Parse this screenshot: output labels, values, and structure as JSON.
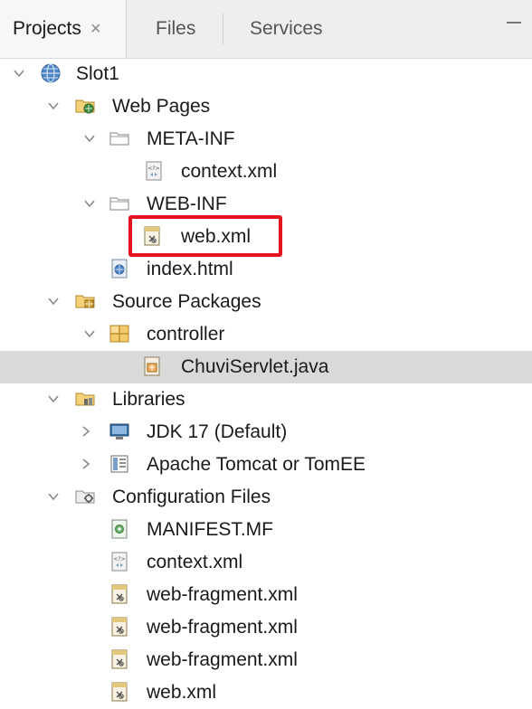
{
  "tabs": [
    {
      "label": "Projects",
      "active": true,
      "close": "×"
    },
    {
      "label": "Files",
      "active": false
    },
    {
      "label": "Services",
      "active": false
    }
  ],
  "tree": [
    {
      "label": "Slot1",
      "icon": "globe-icon",
      "toggle": "expanded"
    },
    {
      "label": "Web Pages",
      "icon": "web-folder-icon",
      "toggle": "expanded"
    },
    {
      "label": "META-INF",
      "icon": "folder-icon",
      "toggle": "expanded"
    },
    {
      "label": "context.xml",
      "icon": "xml-file-icon",
      "toggle": "none"
    },
    {
      "label": "WEB-INF",
      "icon": "folder-icon",
      "toggle": "expanded"
    },
    {
      "label": "web.xml",
      "icon": "web-xml-icon",
      "toggle": "none"
    },
    {
      "label": "index.html",
      "icon": "html-file-icon",
      "toggle": "none"
    },
    {
      "label": "Source Packages",
      "icon": "source-folder-icon",
      "toggle": "expanded"
    },
    {
      "label": "controller",
      "icon": "package-icon",
      "toggle": "expanded"
    },
    {
      "label": "ChuviServlet.java",
      "icon": "servlet-file-icon",
      "toggle": "none",
      "selected": true
    },
    {
      "label": "Libraries",
      "icon": "libraries-icon",
      "toggle": "expanded"
    },
    {
      "label": "JDK 17 (Default)",
      "icon": "jdk-icon",
      "toggle": "collapsed"
    },
    {
      "label": "Apache Tomcat or TomEE",
      "icon": "server-library-icon",
      "toggle": "collapsed"
    },
    {
      "label": "Configuration Files",
      "icon": "config-folder-icon",
      "toggle": "expanded"
    },
    {
      "label": "MANIFEST.MF",
      "icon": "manifest-icon",
      "toggle": "none"
    },
    {
      "label": "context.xml",
      "icon": "xml-file-icon",
      "toggle": "none"
    },
    {
      "label": "web-fragment.xml",
      "icon": "web-xml-icon",
      "toggle": "none"
    },
    {
      "label": "web-fragment.xml",
      "icon": "web-xml-icon",
      "toggle": "none"
    },
    {
      "label": "web-fragment.xml",
      "icon": "web-xml-icon",
      "toggle": "none"
    },
    {
      "label": "web.xml",
      "icon": "web-xml-icon",
      "toggle": "none"
    }
  ],
  "colors": {
    "highlight": "#e3141f",
    "selection": "#d9d9d9",
    "folder": "#f3cb6b"
  }
}
